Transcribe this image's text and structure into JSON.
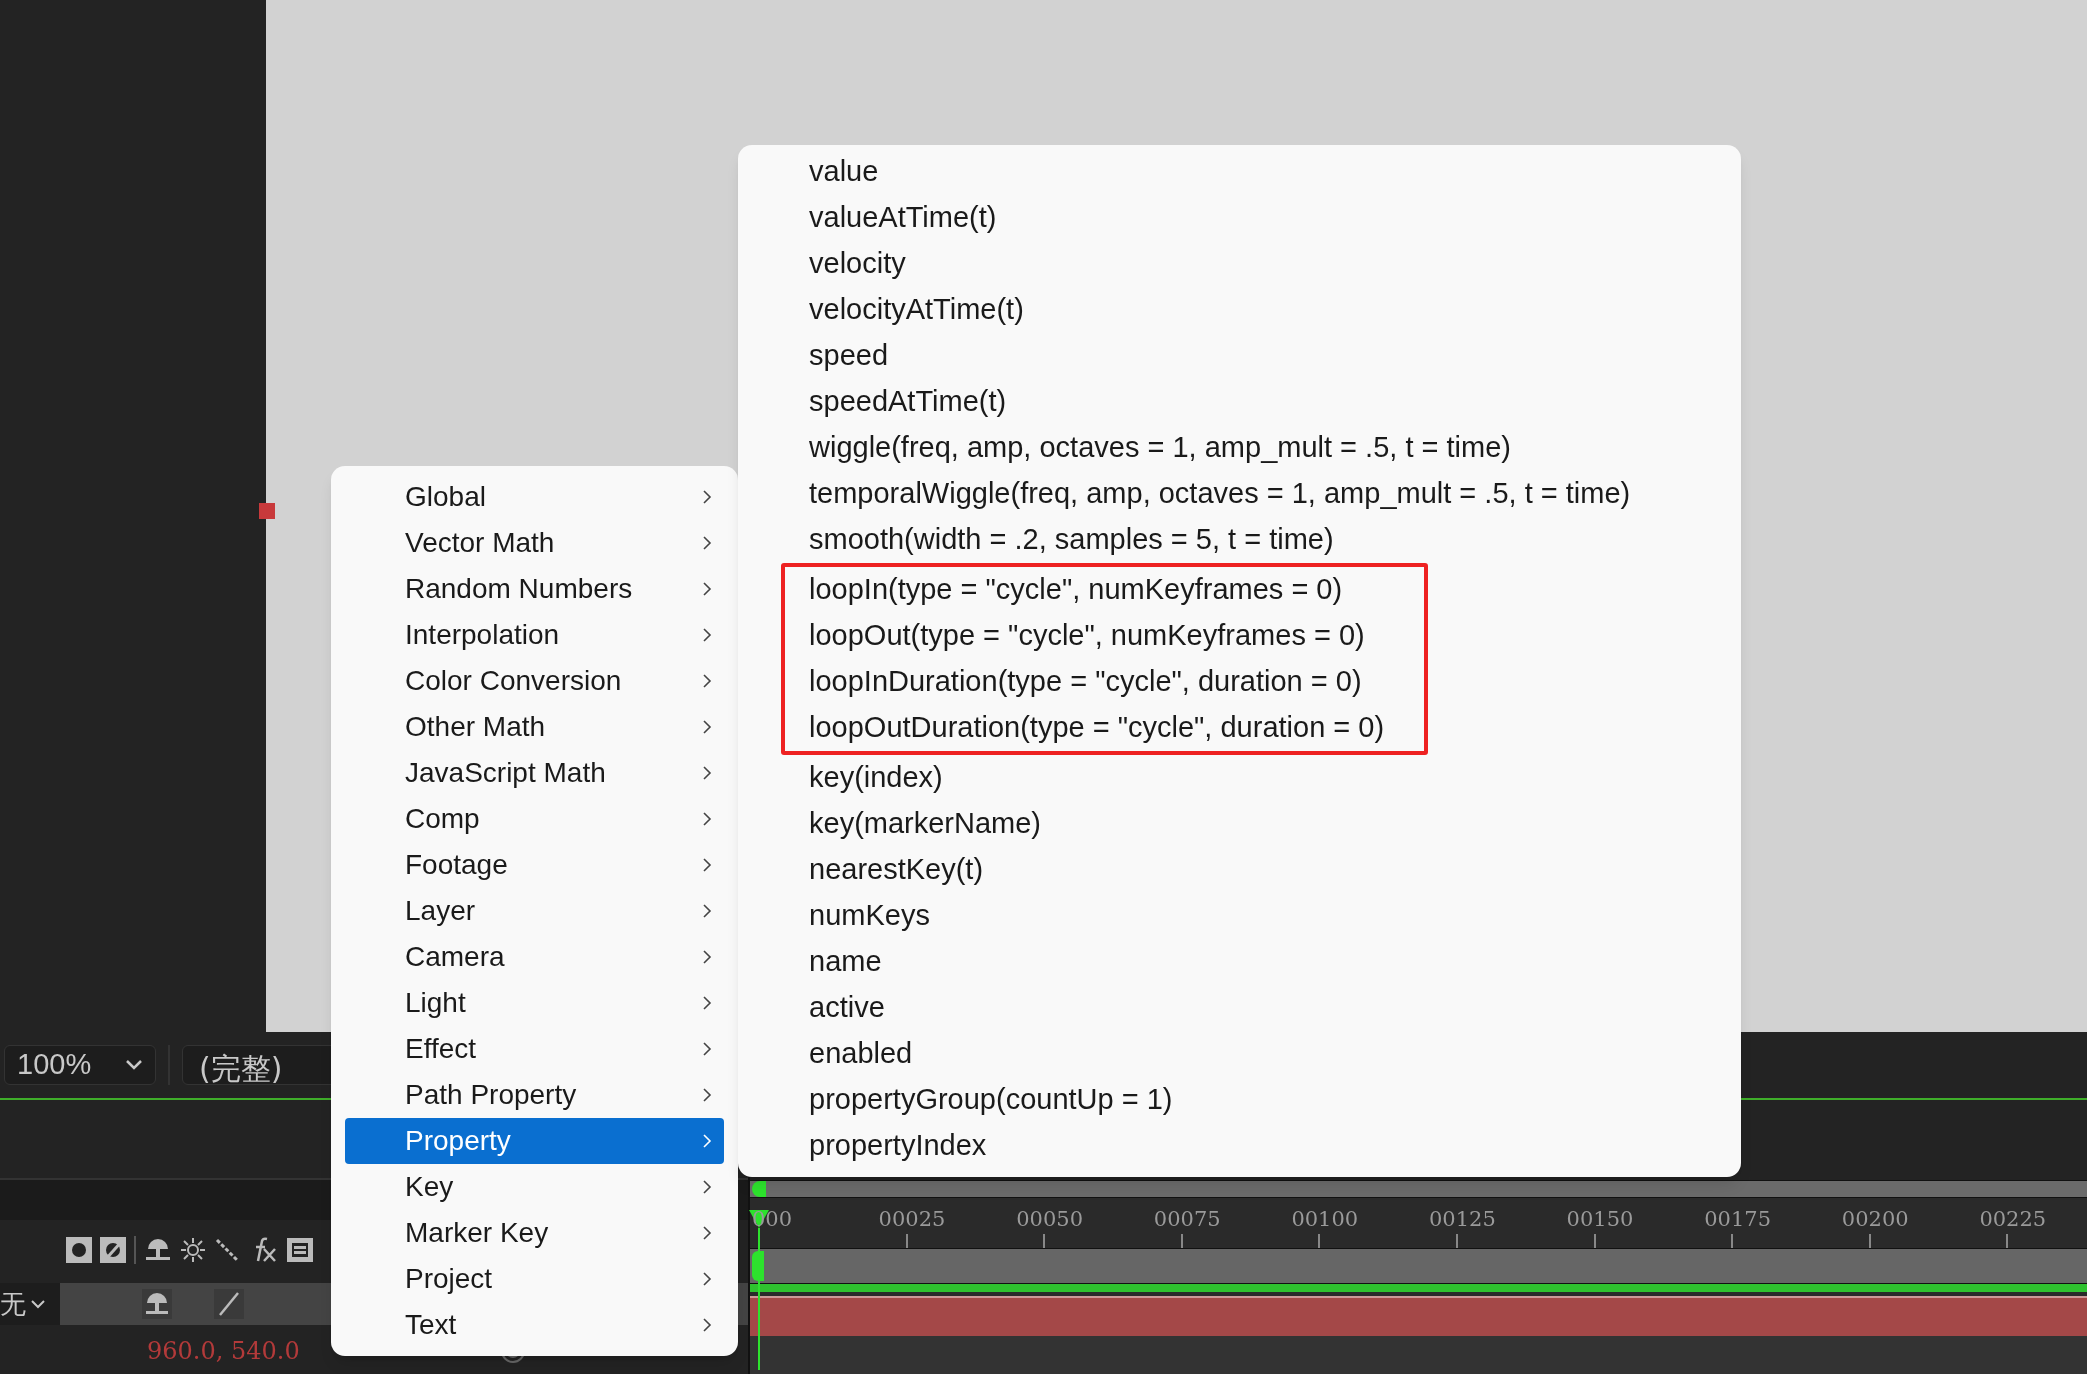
{
  "viewer": {
    "zoom": "100%",
    "resolution": "(完整)"
  },
  "timeline": {
    "ticks": [
      "000",
      "00025",
      "00050",
      "00075",
      "00100",
      "00125",
      "00150",
      "00175",
      "00200",
      "00225"
    ],
    "layer": {
      "parent": "无",
      "position": "960.0, 540.0"
    }
  },
  "menu": {
    "items": [
      {
        "label": "Global",
        "selected": false
      },
      {
        "label": "Vector Math",
        "selected": false
      },
      {
        "label": "Random Numbers",
        "selected": false
      },
      {
        "label": "Interpolation",
        "selected": false
      },
      {
        "label": "Color Conversion",
        "selected": false
      },
      {
        "label": "Other Math",
        "selected": false
      },
      {
        "label": "JavaScript Math",
        "selected": false
      },
      {
        "label": "Comp",
        "selected": false
      },
      {
        "label": "Footage",
        "selected": false
      },
      {
        "label": "Layer",
        "selected": false
      },
      {
        "label": "Camera",
        "selected": false
      },
      {
        "label": "Light",
        "selected": false
      },
      {
        "label": "Effect",
        "selected": false
      },
      {
        "label": "Path Property",
        "selected": false
      },
      {
        "label": "Property",
        "selected": true
      },
      {
        "label": "Key",
        "selected": false
      },
      {
        "label": "Marker Key",
        "selected": false
      },
      {
        "label": "Project",
        "selected": false
      },
      {
        "label": "Text",
        "selected": false
      }
    ]
  },
  "submenu": {
    "items": [
      {
        "label": "value",
        "boxed": false
      },
      {
        "label": "valueAtTime(t)",
        "boxed": false
      },
      {
        "label": "velocity",
        "boxed": false
      },
      {
        "label": "velocityAtTime(t)",
        "boxed": false
      },
      {
        "label": "speed",
        "boxed": false
      },
      {
        "label": "speedAtTime(t)",
        "boxed": false
      },
      {
        "label": "wiggle(freq, amp, octaves = 1, amp_mult = .5, t = time)",
        "boxed": false
      },
      {
        "label": "temporalWiggle(freq, amp, octaves = 1, amp_mult = .5, t = time)",
        "boxed": false
      },
      {
        "label": "smooth(width = .2, samples = 5, t = time)",
        "boxed": false
      },
      {
        "label": "loopIn(type = \"cycle\", numKeyframes = 0)",
        "boxed": true
      },
      {
        "label": "loopOut(type = \"cycle\", numKeyframes = 0)",
        "boxed": true
      },
      {
        "label": "loopInDuration(type = \"cycle\", duration = 0)",
        "boxed": true
      },
      {
        "label": "loopOutDuration(type = \"cycle\", duration = 0)",
        "boxed": true
      },
      {
        "label": "key(index)",
        "boxed": false
      },
      {
        "label": "key(markerName)",
        "boxed": false
      },
      {
        "label": "nearestKey(t)",
        "boxed": false
      },
      {
        "label": "numKeys",
        "boxed": false
      },
      {
        "label": "name",
        "boxed": false
      },
      {
        "label": "active",
        "boxed": false
      },
      {
        "label": "enabled",
        "boxed": false
      },
      {
        "label": "propertyGroup(countUp = 1)",
        "boxed": false
      },
      {
        "label": "propertyIndex",
        "boxed": false
      }
    ]
  }
}
